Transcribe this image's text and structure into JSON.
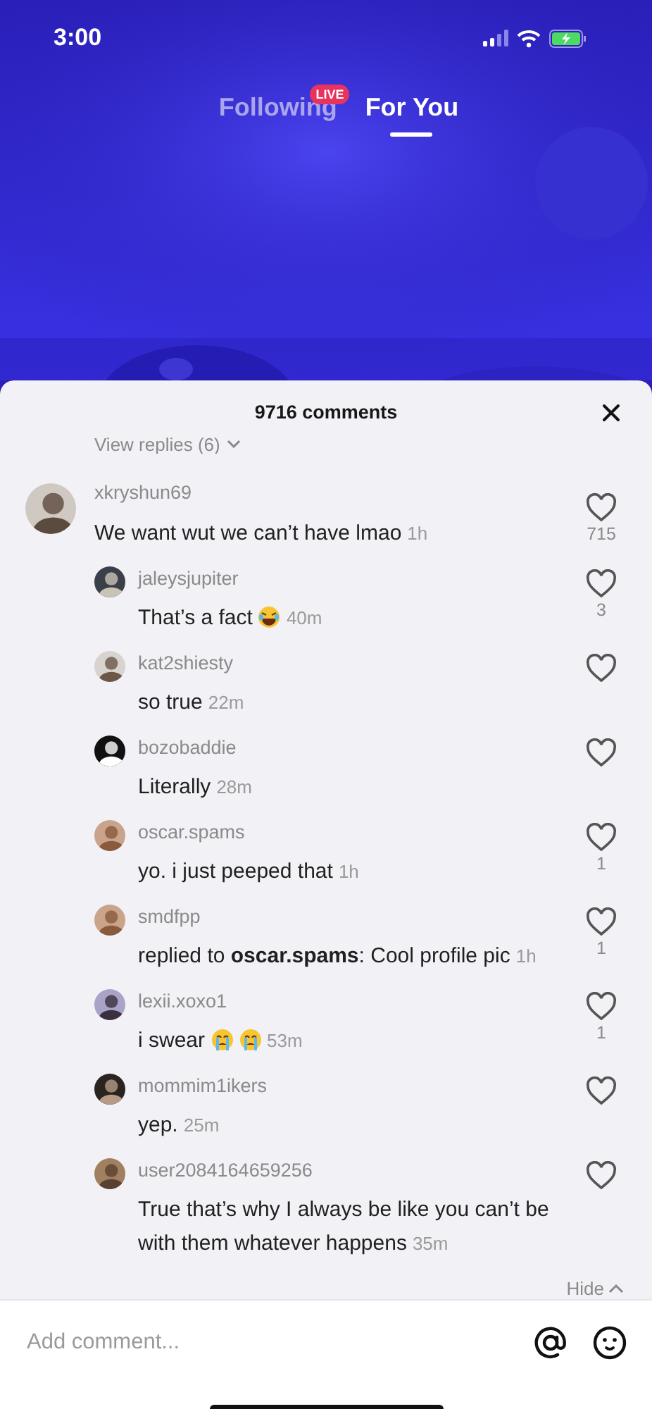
{
  "status_bar": {
    "time": "3:00"
  },
  "feed_tabs": [
    {
      "label": "Following",
      "selected": false,
      "badge": "LIVE"
    },
    {
      "label": "For You",
      "selected": true
    }
  ],
  "comments_sheet": {
    "title": "9716 comments",
    "view_replies": "View replies (6)",
    "comments": [
      {
        "user": "xkryshun69",
        "text": "We want wut we can’t have lmao",
        "time": "1h",
        "likes": "715",
        "liked": false,
        "children": [
          {
            "user": "jaleysjupiter",
            "text": "That’s a fact",
            "emoji_icons": [
              {
                "kind": "laugh"
              }
            ],
            "time": "40m",
            "likes": "3",
            "liked": false
          },
          {
            "user": "kat2shiesty",
            "text": "so true",
            "time": "22m",
            "liked": false
          },
          {
            "user": "bozobaddie",
            "text": "Literally",
            "time": "28m",
            "liked": false
          },
          {
            "user": "oscar.spams",
            "text": "yo. i just peeped that",
            "time": "1h",
            "likes": "1",
            "liked": false
          },
          {
            "user": "smdfpp",
            "text": "replied to **oscar.spams**: Cool profile pic",
            "time": "1h",
            "likes": "1",
            "liked": false
          },
          {
            "user": "lexii.xoxo1",
            "text": "i swear",
            "emoji_icons": [
              {
                "kind": "cry"
              },
              {
                "kind": "cry"
              }
            ],
            "time": "53m",
            "likes": "1",
            "liked": false
          },
          {
            "user": "mommim1ikers",
            "text": "yep.",
            "time": "25m",
            "liked": false
          },
          {
            "user": "user2084164659256",
            "text": "True that’s why I always be like you can’t be with them whatever happens",
            "time": "35m",
            "liked": false
          }
        ]
      }
    ],
    "hide": "Hide"
  },
  "composer": {
    "placeholder": "Add comment..."
  }
}
